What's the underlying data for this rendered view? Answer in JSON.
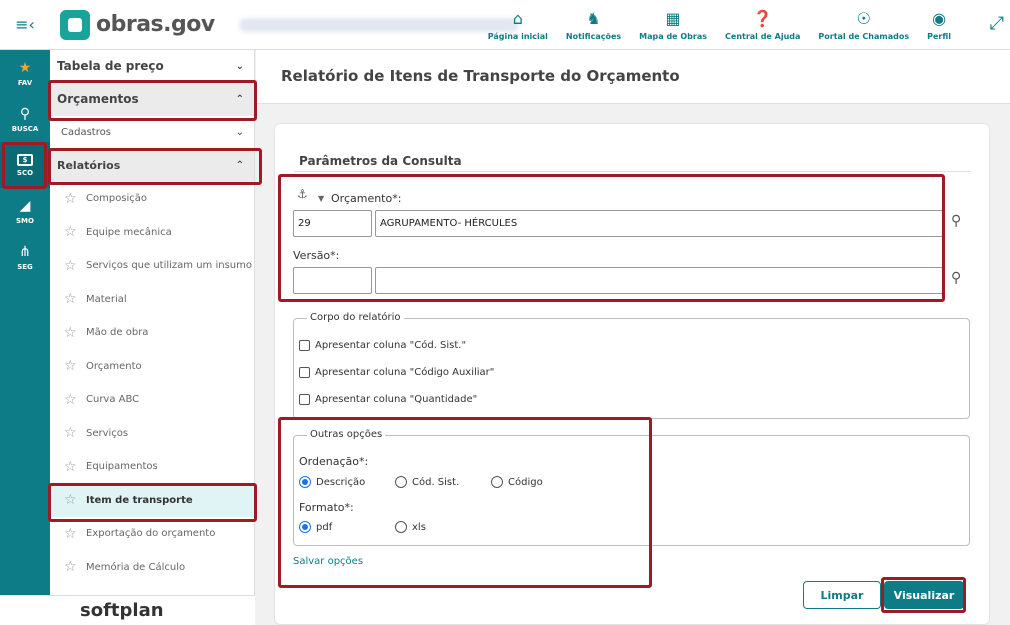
{
  "header": {
    "logo_text": "obras.gov",
    "nav": [
      {
        "label": "Página inicial",
        "icon": "home-icon"
      },
      {
        "label": "Notificações",
        "icon": "bell-icon"
      },
      {
        "label": "Mapa de Obras",
        "icon": "map-icon"
      },
      {
        "label": "Central de Ajuda",
        "icon": "help-icon"
      },
      {
        "label": "Portal de Chamados",
        "icon": "lifebuoy-icon"
      },
      {
        "label": "Perfil",
        "icon": "user-icon"
      }
    ]
  },
  "rail": [
    {
      "label": "FAV",
      "icon": "star-icon"
    },
    {
      "label": "BUSCA",
      "icon": "search-icon"
    },
    {
      "label": "SCO",
      "icon": "sco-icon",
      "badge": "$"
    },
    {
      "label": "SMO",
      "icon": "ruler-icon"
    },
    {
      "label": "SEG",
      "icon": "merge-icon"
    }
  ],
  "sidebar": {
    "tabela": "Tabela de preço",
    "orcamentos": "Orçamentos",
    "cadastros": "Cadastros",
    "relatorios": "Relatórios",
    "items": [
      "Composição",
      "Equipe mecânica",
      "Serviços que utilizam um insumo",
      "Material",
      "Mão de obra",
      "Orçamento",
      "Curva ABC",
      "Serviços",
      "Equipamentos",
      "Item de transporte",
      "Exportação do orçamento",
      "Memória de Cálculo"
    ],
    "active_item": "Item de transporte"
  },
  "footer_brand": "softplan",
  "page": {
    "title": "Relatório de Itens de Transporte do Orçamento",
    "section_title": "Parâmetros da Consulta",
    "orcamento_label": "Orçamento*:",
    "orcamento_code": "29",
    "orcamento_desc": "AGRUPAMENTO- HÉRCULES",
    "versao_label": "Versão*:",
    "versao_code": "",
    "versao_desc": "",
    "corpo": {
      "legend": "Corpo do relatório",
      "options": [
        "Apresentar coluna \"Cód. Sist.\"",
        "Apresentar coluna \"Código Auxiliar\"",
        "Apresentar coluna \"Quantidade\""
      ]
    },
    "outras": {
      "legend": "Outras opções",
      "ordenacao_label": "Ordenação*:",
      "ordenacao_options": [
        "Descrição",
        "Cód. Sist.",
        "Código"
      ],
      "ordenacao_selected": "Descrição",
      "formato_label": "Formato*:",
      "formato_options": [
        "pdf",
        "xls"
      ],
      "formato_selected": "pdf"
    },
    "salvar_link": "Salvar opções",
    "limpar_button": "Limpar",
    "visualizar_button": "Visualizar"
  },
  "colors": {
    "brand": "#0e7c86",
    "highlight": "#9e1b23",
    "radio_selected": "#1a73e8"
  }
}
